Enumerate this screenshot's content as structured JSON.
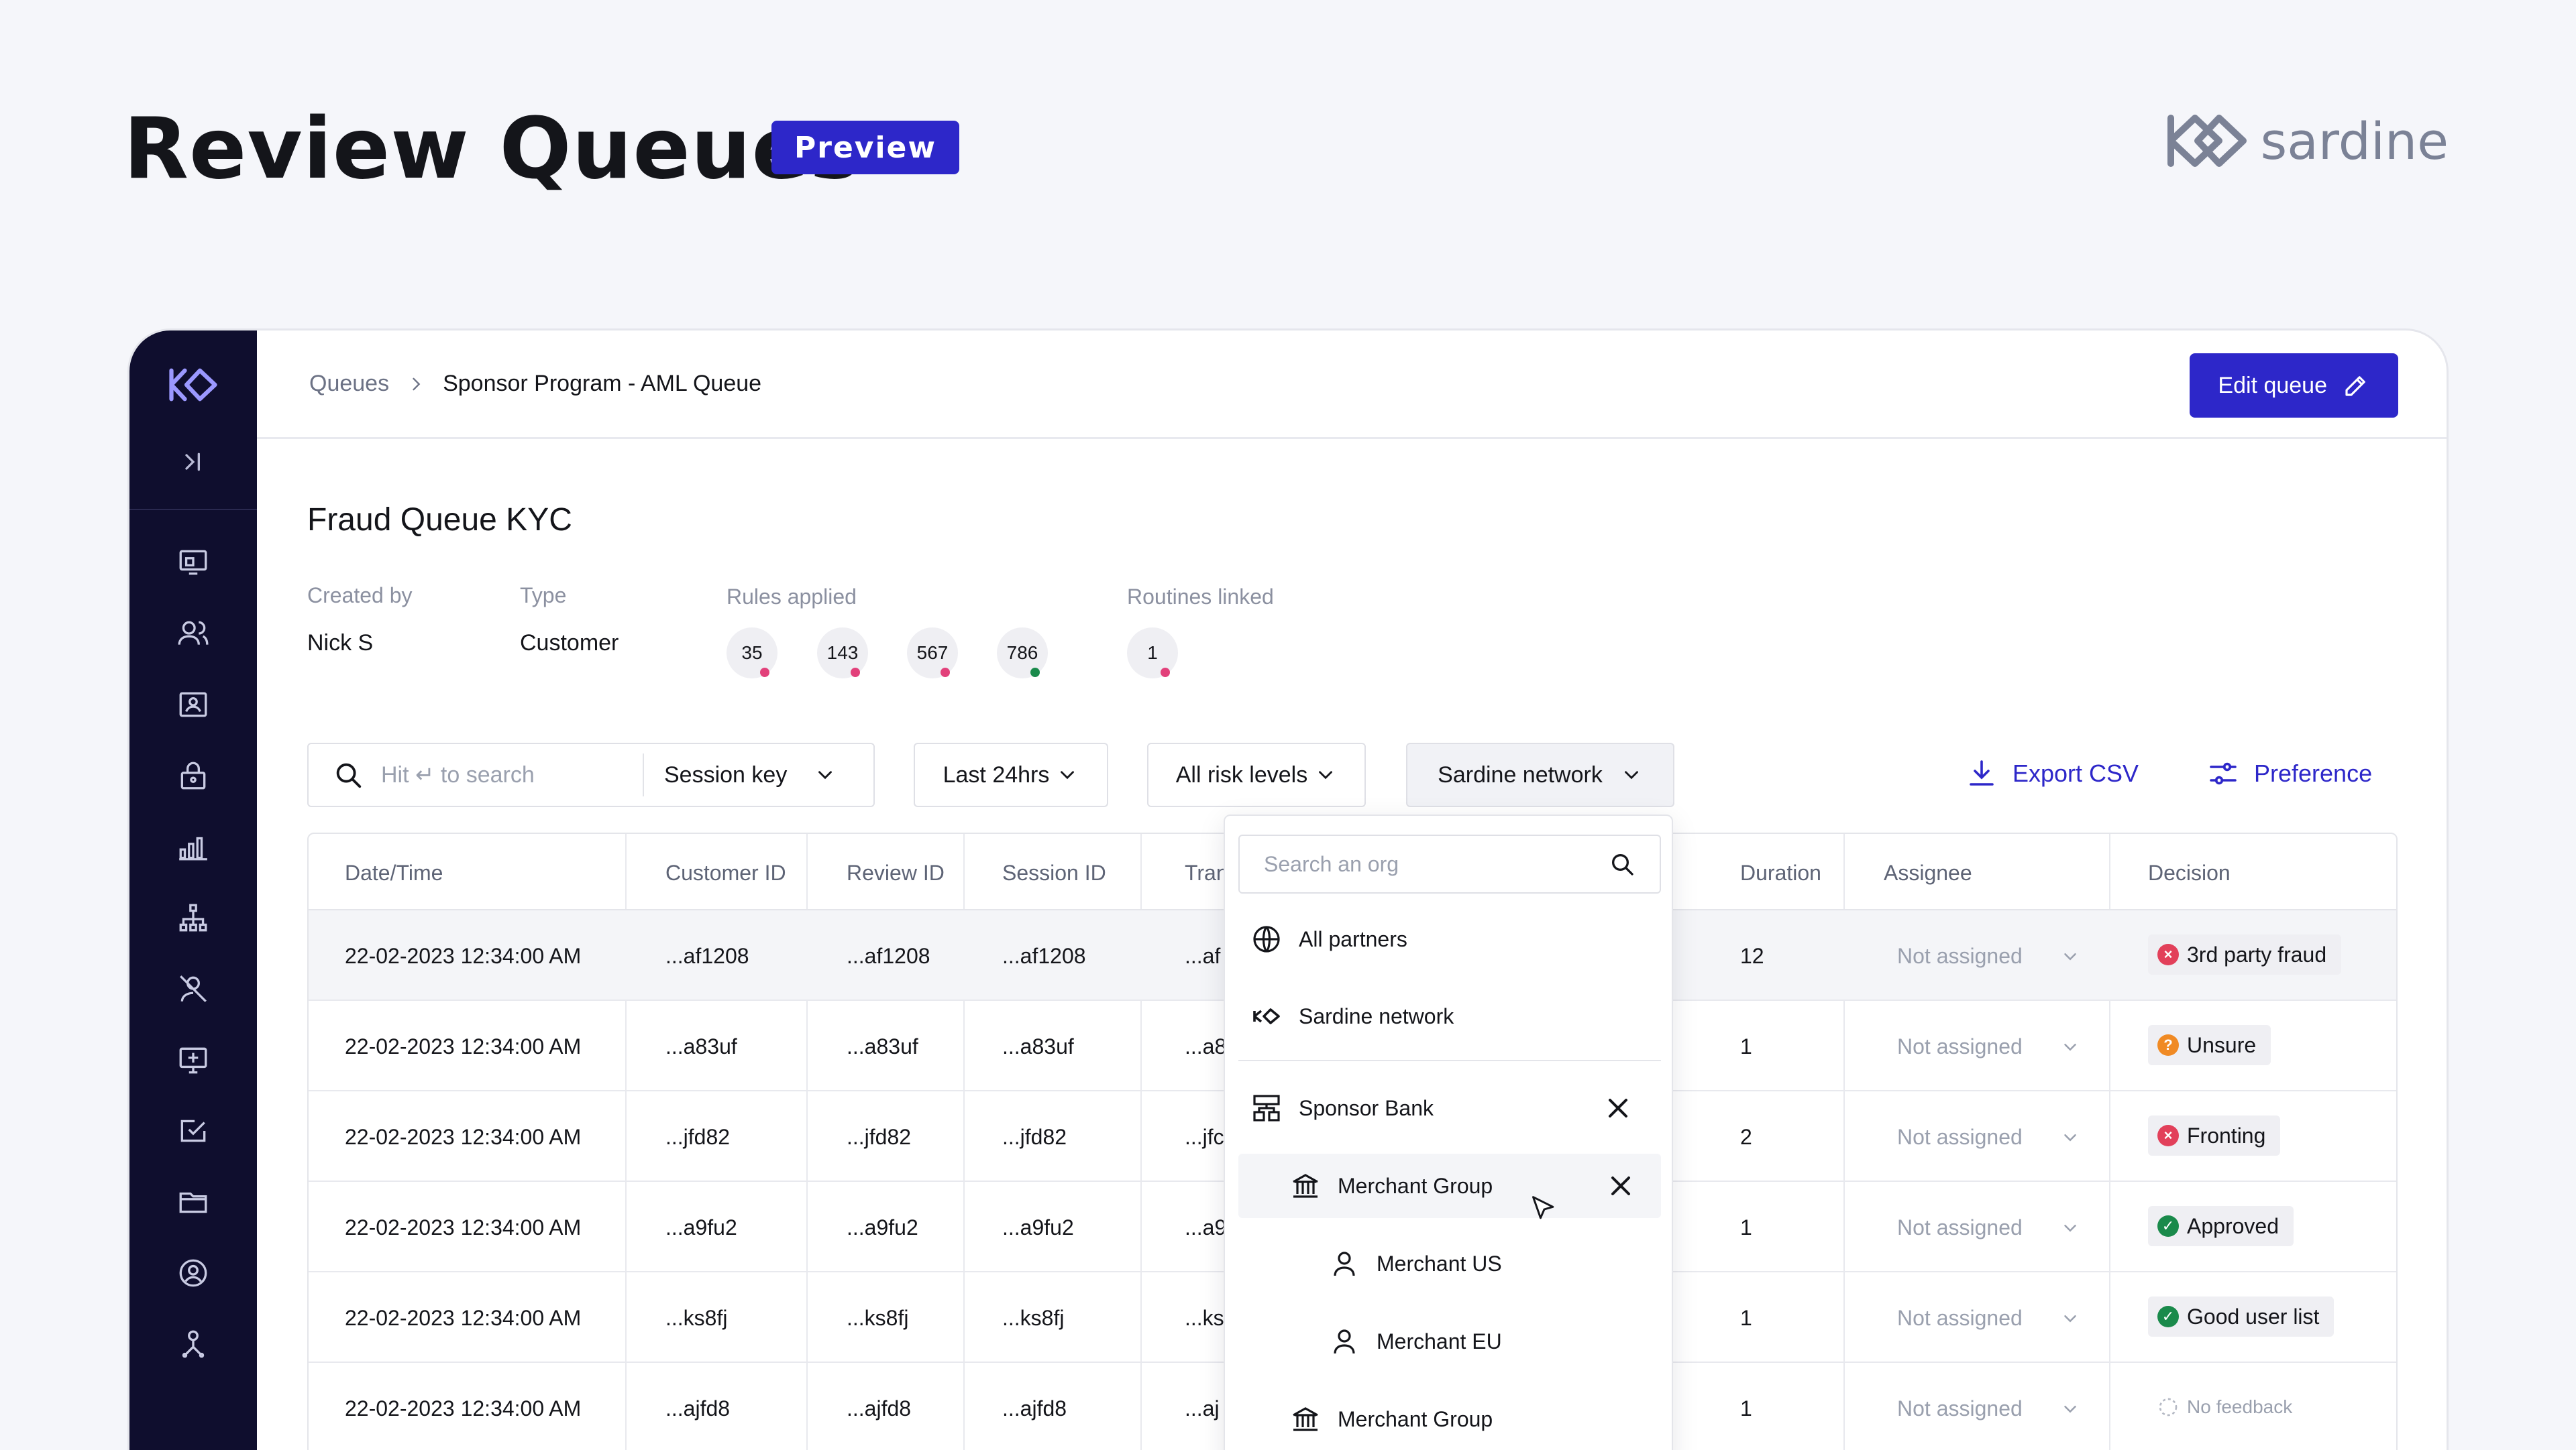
{
  "hero": {
    "title": "Review Queues",
    "badge": "Preview",
    "brand": "sardine"
  },
  "topbar": {
    "crumb_root": "Queues",
    "crumb_current": "Sponsor Program - AML Queue",
    "edit_label": "Edit queue"
  },
  "queue": {
    "title": "Fraud Queue KYC",
    "created_by_label": "Created by",
    "created_by": "Nick S",
    "type_label": "Type",
    "type": "Customer",
    "rules_label": "Rules applied",
    "rules": [
      {
        "id": "35",
        "dot": "#e2407a"
      },
      {
        "id": "143",
        "dot": "#e2407a"
      },
      {
        "id": "567",
        "dot": "#e2407a"
      },
      {
        "id": "786",
        "dot": "#1a8a4b"
      }
    ],
    "routines_label": "Routines linked",
    "routines": [
      {
        "id": "1",
        "dot": "#e2407a"
      }
    ]
  },
  "filters": {
    "search_placeholder": "Hit ↵ to search",
    "session_key": "Session key",
    "time": "Last 24hrs",
    "risk": "All risk levels",
    "network": "Sardine network",
    "export": "Export CSV",
    "preference": "Preference"
  },
  "table": {
    "headers": {
      "datetime": "Date/Time",
      "customer": "Customer ID",
      "review": "Review ID",
      "session": "Session ID",
      "tran": "Tran",
      "duration": "Duration",
      "assignee": "Assignee",
      "decision": "Decision"
    },
    "rows": [
      {
        "datetime": "22-02-2023   12:34:00 AM",
        "customer": "...af1208",
        "review": "...af1208",
        "session": "...af1208",
        "tran": "...af",
        "duration": "12",
        "assignee": "Not assigned",
        "decision": "3rd party fraud",
        "status": "fraud"
      },
      {
        "datetime": "22-02-2023   12:34:00 AM",
        "customer": "...a83uf",
        "review": "...a83uf",
        "session": "...a83uf",
        "tran": "...a8",
        "duration": "1",
        "assignee": "Not assigned",
        "decision": "Unsure",
        "status": "unsure"
      },
      {
        "datetime": "22-02-2023   12:34:00 AM",
        "customer": "...jfd82",
        "review": "...jfd82",
        "session": "...jfd82",
        "tran": "...jfc",
        "duration": "2",
        "assignee": "Not assigned",
        "decision": "Fronting",
        "status": "fraud"
      },
      {
        "datetime": "22-02-2023   12:34:00 AM",
        "customer": "...a9fu2",
        "review": "...a9fu2",
        "session": "...a9fu2",
        "tran": "...a9",
        "duration": "1",
        "assignee": "Not assigned",
        "decision": "Approved",
        "status": "ok"
      },
      {
        "datetime": "22-02-2023   12:34:00 AM",
        "customer": "...ks8fj",
        "review": "...ks8fj",
        "session": "...ks8fj",
        "tran": "...ks",
        "duration": "1",
        "assignee": "Not assigned",
        "decision": "Good user list",
        "status": "ok"
      },
      {
        "datetime": "22-02-2023   12:34:00 AM",
        "customer": "...ajfd8",
        "review": "...ajfd8",
        "session": "...ajfd8",
        "tran": "...aj",
        "duration": "1",
        "assignee": "Not assigned",
        "decision": "No feedback",
        "status": "none"
      }
    ]
  },
  "dropdown": {
    "search_placeholder": "Search an org",
    "all_partners": "All partners",
    "sardine_network": "Sardine network",
    "sponsor_bank": "Sponsor Bank",
    "merchant_group": "Merchant Group",
    "merchant_us": "Merchant US",
    "merchant_eu": "Merchant EU",
    "merchant_group_2": "Merchant Group"
  },
  "colors": {
    "accent": "#2d27c9",
    "sidebar": "#0f0e2e",
    "fraud": "#e2405a",
    "unsure": "#f08a24",
    "ok": "#1a8a4b"
  }
}
